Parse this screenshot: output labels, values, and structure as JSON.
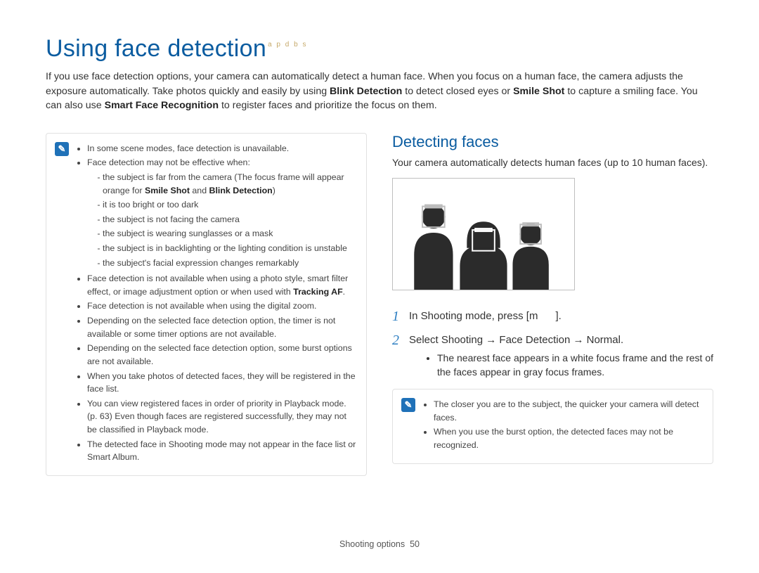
{
  "title": "Using face detection",
  "title_mode_badge": "a p d b s",
  "intro_parts": {
    "p1": "If you use face detection options, your camera can automatically detect a human face. When you focus on a human face, the camera adjusts the exposure automatically. Take photos quickly and easily by using ",
    "b1": "Blink Detection",
    "p2": " to detect closed eyes or ",
    "b2": "Smile Shot",
    "p3": " to capture a smiling face. You can also use ",
    "b3": "Smart Face Recognition",
    "p4": " to register faces and prioritize the focus on them."
  },
  "left_note": {
    "items": [
      "In some scene modes, face detection is unavailable.",
      "Face detection may not be effective when:"
    ],
    "sub_intro_idx": 1,
    "sub": [
      "the subject is far from the camera (The focus frame will appear orange for ",
      " and ",
      ")",
      "it is too bright or too dark",
      "the subject is not facing the camera",
      "the subject is wearing sunglasses or a mask",
      "the subject is in backlighting or the lighting condition is unstable",
      "the subject's facial expression changes remarkably"
    ],
    "sub_bold": {
      "smile": "Smile Shot",
      "blink": "Blink Detection"
    },
    "items_after": [
      "Face detection is not available when using a photo style, smart filter effect, or image adjustment option or when used with ",
      "Face detection is not available when using the digital zoom.",
      "Depending on the selected face detection option, the timer is not available or some timer options are not available.",
      "Depending on the selected face detection option, some burst options are not available.",
      "When you take photos of detected faces, they will be registered in the face list.",
      "You can view registered faces in order of priority in Playback mode. (p. 63) Even though faces are registered successfully, they may not be classified in Playback mode.",
      "The detected face in Shooting mode may not appear in the face list or Smart Album."
    ],
    "items_after_bold": {
      "tracking": "Tracking AF"
    }
  },
  "section_heading": "Detecting faces",
  "section_lead": "Your camera automatically detects human faces (up to 10 human faces).",
  "steps": [
    {
      "num": "1",
      "text_pre": "In Shooting mode, press [",
      "key": "m",
      "text_post": "]."
    },
    {
      "num": "2",
      "text": "Select Shooting → Face Detection → Normal."
    }
  ],
  "step_note": "The nearest face appears in a white focus frame and the rest of the faces appear in gray focus frames.",
  "right_note": [
    "The closer you are to the subject, the quicker your camera will detect faces.",
    "When you use the burst option, the detected faces may not be recognized."
  ],
  "footer_section": "Shooting options",
  "footer_page": "50"
}
